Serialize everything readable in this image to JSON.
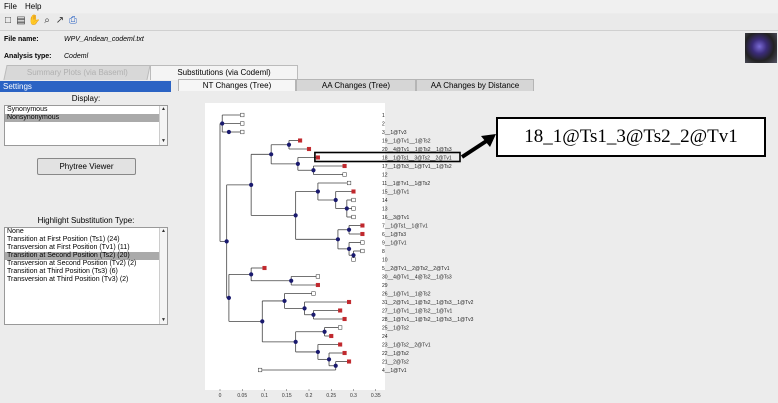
{
  "menu": {
    "file": "File",
    "help": "Help"
  },
  "toolbar": {
    "icons": [
      "new-file-icon",
      "import-icon",
      "pan-hand-icon",
      "zoom-icon",
      "select-icon",
      "print-icon"
    ]
  },
  "info": {
    "file_label": "File name:",
    "file_value": "WPV_Andean_codeml.txt",
    "analysis_label": "Analysis type:",
    "analysis_value": "Codeml"
  },
  "main_tabs": [
    {
      "label": "Summary Plots (via Baseml)",
      "active": false
    },
    {
      "label": "Substitutions (via Codeml)",
      "active": true
    }
  ],
  "settings": {
    "header": "Settings",
    "display_label": "Display:",
    "display_options": [
      "Synonymous",
      "Nonsynonymous"
    ],
    "display_selected": "Nonsynonymous",
    "phytree_button": "Phytree Viewer",
    "highlight_label": "Highlight Substitution Type:",
    "highlight_options": [
      "None",
      "Transition at First Position (Ts1) (24)",
      "Transversion at First Position (Tv1) (11)",
      "Transition at Second Position (Ts2) (20)",
      "Transversion at Second Position (Tv2) (2)",
      "Transition at Third Position (Ts3) (6)",
      "Transversion at Third Position (Tv3) (2)"
    ],
    "highlight_selected": "Transition at Second Position (Ts2) (20)"
  },
  "sub_tabs": [
    {
      "label": "NT Changes (Tree)",
      "active": true
    },
    {
      "label": "AA Changes (Tree)",
      "active": false
    },
    {
      "label": "AA Changes by Distance",
      "active": false
    }
  ],
  "tree": {
    "x_ticks": [
      "0",
      "0.05",
      "0.1",
      "0.15",
      "0.2",
      "0.25",
      "0.3",
      "0.35"
    ],
    "leaves": [
      "1",
      "2",
      "3__1@Tv3",
      "19__1@Tv1__1@Ts2",
      "20__4@Tv1__1@Ts2__1@Ts3",
      "18__1@Ts1__3@Ts2__2@Tv1",
      "17__1@Ts3__1@Tv1__1@Ts2",
      "12",
      "11__1@Tv1__1@Ts2",
      "15__1@Tv1",
      "14",
      "13",
      "16__3@Tv1",
      "7__1@Ts1__1@Tv1",
      "6__1@Ts3",
      "9__1@Tv1",
      "8",
      "10",
      "5__2@Tv1__2@Ts2__2@Tv1",
      "30__4@Tv1__4@Ts2__1@Ts3",
      "29",
      "26__1@Tv1__1@Ts2",
      "31__2@Tv1__1@Ts2__1@Ts3__1@Tv2",
      "27__1@Tv1__1@Ts2__1@Tv1",
      "28__1@Tv1__1@Ts2__1@Ts3__1@Tv3",
      "25__1@Ts2",
      "24",
      "23__1@Ts2__2@Tv1",
      "22__1@Ts2",
      "21__2@Ts2",
      "4__1@Tv1"
    ],
    "highlighted_leaf": "18__1@Ts1__3@Ts2__2@Tv1"
  },
  "callout_text": "18_1@Ts1_3@Ts2_2@Tv1",
  "colors": {
    "accent": "#2b63c4",
    "node": "#1a1a6e",
    "mark_red": "#c0282d"
  }
}
